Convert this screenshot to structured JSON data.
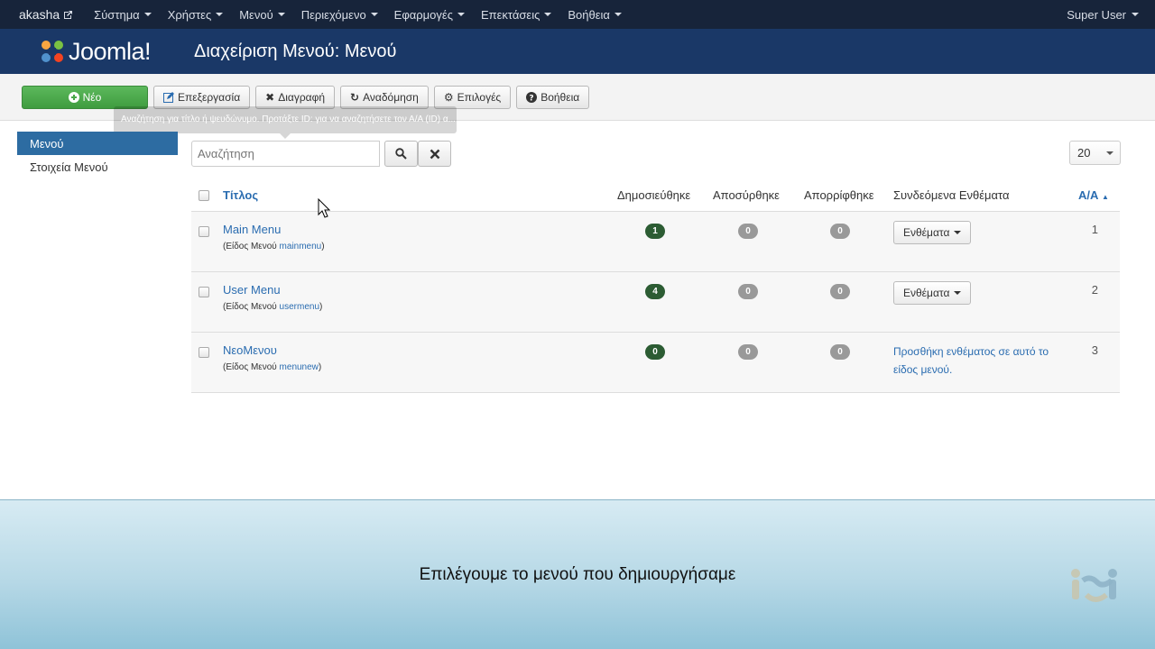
{
  "navbar": {
    "brand": "akasha",
    "items": [
      {
        "label": "Σύστημα"
      },
      {
        "label": "Χρήστες"
      },
      {
        "label": "Μενού"
      },
      {
        "label": "Περιεχόμενο"
      },
      {
        "label": "Εφαρμογές"
      },
      {
        "label": "Επεκτάσεις"
      },
      {
        "label": "Βοήθεια"
      }
    ],
    "user": "Super User"
  },
  "header": {
    "logo_text": "Joomla!",
    "title": "Διαχείριση Μενού: Μενού"
  },
  "toolbar": {
    "new": "Νέο",
    "edit": "Επεξεργασία",
    "delete": "Διαγραφή",
    "rebuild": "Αναδόμηση",
    "options": "Επιλογές",
    "help": "Βοήθεια"
  },
  "tooltip": "Αναζήτηση για τίτλο ή ψευδώνυμο. Προτάξτε ID: για να αναζητήσετε τον Α/Α (ID) α...",
  "sidebar": {
    "items": [
      {
        "label": "Μενού",
        "active": true
      },
      {
        "label": "Στοιχεία Μενού",
        "active": false
      }
    ]
  },
  "search": {
    "placeholder": "Αναζήτηση"
  },
  "list_limit": "20",
  "table": {
    "headers": {
      "title": "Τίτλος",
      "published": "Δημοσιεύθηκε",
      "unpublished": "Αποσύρθηκε",
      "trashed": "Απορρίφθηκε",
      "modules": "Συνδεόμενα Ενθέματα",
      "id": "Α/Α"
    },
    "rows": [
      {
        "title": "Main Menu",
        "type_label": "(Είδος Μενού",
        "type": "mainmenu",
        "close": ")",
        "published": "1",
        "unpublished": "0",
        "trashed": "0",
        "modules_button": "Ενθέματα",
        "id": "1"
      },
      {
        "title": "User Menu",
        "type_label": "(Είδος Μενού",
        "type": "usermenu",
        "close": ")",
        "published": "4",
        "unpublished": "0",
        "trashed": "0",
        "modules_button": "Ενθέματα",
        "id": "2"
      },
      {
        "title": "ΝεοΜενου",
        "type_label": "(Είδος Μενού",
        "type": "menunew",
        "close": ")",
        "published": "0",
        "unpublished": "0",
        "trashed": "0",
        "modules_link": "Προσθήκη ενθέματος σε αυτό το είδος μενού.",
        "id": "3"
      }
    ]
  },
  "caption": "Επιλέγουμε το μενού που δημιουργήσαμε",
  "colors": {
    "navbar": "#17243a",
    "header": "#1a3867",
    "new_button": "#5cb85c",
    "active_sidebar": "#2d6ca2",
    "link": "#2a6cb0",
    "badge_published": "#2c5c33",
    "badge_zero": "#999999"
  }
}
